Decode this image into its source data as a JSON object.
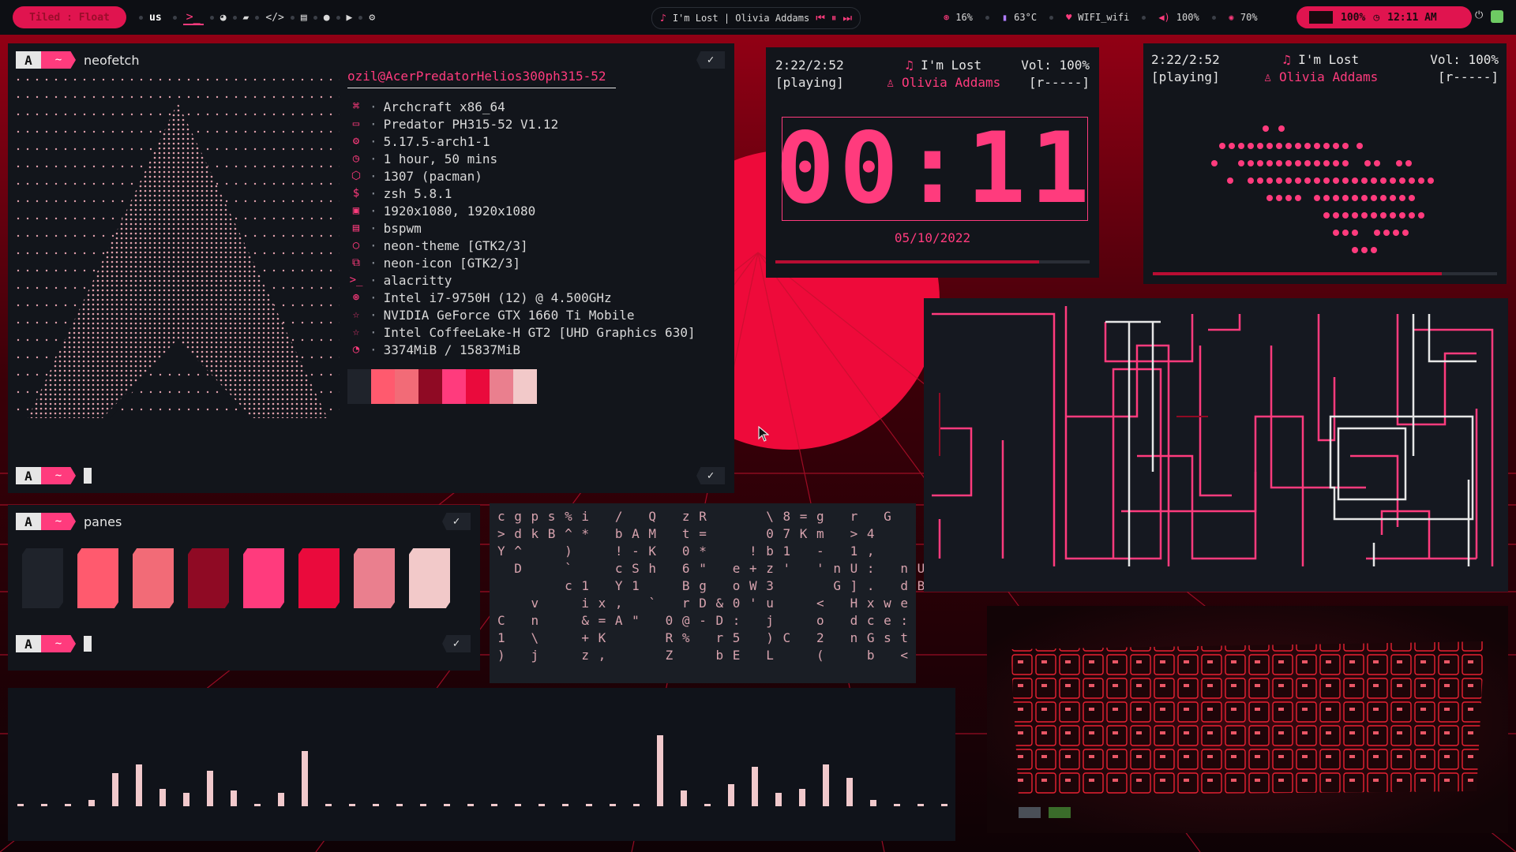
{
  "topbar": {
    "layout_label": "Tiled : Float",
    "keyboard_layout": "us",
    "workspace_icons": [
      "terminal-icon",
      "firefox-icon",
      "folder-icon",
      "code-icon",
      "notes-icon",
      "chat-icon",
      "youtube-icon",
      "settings-icon"
    ],
    "now_playing": "I'm Lost | Olivia Addams",
    "cpu": "16%",
    "temp": "63°C",
    "wifi": "WIFI_wifi",
    "volume": "100%",
    "brightness": "70%",
    "battery": "100%",
    "time": "12:11 AM",
    "accent": "#ff3b7d",
    "accent_dark": "#e0144f"
  },
  "neofetch": {
    "title": "neofetch",
    "prompt_a": "A",
    "prompt_b": "~",
    "host": "ozil@AcerPredatorHelios300ph315-52",
    "rows": [
      {
        "icon": "⌘",
        "value": "Archcraft x86_64"
      },
      {
        "icon": "▭",
        "value": "Predator PH315-52 V1.12"
      },
      {
        "icon": "⚙",
        "value": "5.17.5-arch1-1"
      },
      {
        "icon": "◷",
        "value": "1 hour, 50 mins"
      },
      {
        "icon": "⬡",
        "value": "1307 (pacman)"
      },
      {
        "icon": "$",
        "value": "zsh 5.8.1"
      },
      {
        "icon": "▣",
        "value": "1920x1080, 1920x1080"
      },
      {
        "icon": "▤",
        "value": "bspwm"
      },
      {
        "icon": "○",
        "value": "neon-theme [GTK2/3]"
      },
      {
        "icon": "⧉",
        "value": "neon-icon [GTK2/3]"
      },
      {
        "icon": ">_",
        "value": "alacritty"
      },
      {
        "icon": "⊛",
        "value": "Intel i7-9750H (12) @ 4.500GHz"
      },
      {
        "icon": "☆",
        "value": "NVIDIA GeForce GTX 1660 Ti Mobile"
      },
      {
        "icon": "☆",
        "value": "Intel CoffeeLake-H GT2 [UHD Graphics 630]"
      },
      {
        "icon": "◔",
        "value": "3374MiB / 15837MiB"
      }
    ],
    "palette": [
      "#1f232b",
      "#ff5a6e",
      "#f26b77",
      "#8f0a24",
      "#ff3b7d",
      "#ea0a3c",
      "#ea7f8e",
      "#f2c9c9"
    ]
  },
  "panes": {
    "title": "panes",
    "prompt_a": "A",
    "prompt_b": "~",
    "colors": [
      "#1f232b",
      "#ff5a6e",
      "#f26b77",
      "#8f0a24",
      "#ff3b7d",
      "#ea0a3c",
      "#ea7f8e",
      "#f2c9c9"
    ]
  },
  "matrix": {
    "lines": [
      "c g p s % i   /   Q   z R       \\ 8 = g   r   G",
      "> d k B ^ *   b A M   t =       0 7 K m   > 4",
      "Y ^     )     ! - K   0 *     ! b 1   -   1 ,",
      "  D     `     c S h   6 \"   e + z '   ' n U :   n U",
      "        c 1   Y 1     B g   o W 3       G ] .   d B",
      "    v     i x ,   `   r D & 0 ' u     <   H x w e",
      "C   n     & = A \"   0 @ - D :   j     o   d c e :",
      "1   \\     + K       R %   r 5   ) C   2   n G s t",
      ")   j     z ,       Z     b E   L     (     b   <"
    ]
  },
  "music_widget": {
    "position": "2:22/2:52",
    "state": "[playing]",
    "title": "I'm Lost",
    "artist": "Olivia Addams",
    "volume": "Vol: 100%",
    "repeat": "[r-----]",
    "clock": "00:11",
    "date": "05/10/2022",
    "progress": 0.84
  },
  "music_widget2": {
    "position": "2:22/2:52",
    "state": "[playing]",
    "title": "I'm Lost",
    "artist": "Olivia Addams",
    "volume": "Vol: 100%",
    "repeat": "[r-----]",
    "progress": 0.84
  },
  "visualizer": {
    "bars": [
      0.02,
      0.02,
      0.02,
      0.06,
      0.3,
      0.38,
      0.16,
      0.12,
      0.32,
      0.14,
      0.02,
      0.12,
      0.5,
      0.02,
      0.02,
      0.02,
      0.02,
      0.02,
      0.02,
      0.02,
      0.02,
      0.02,
      0.02,
      0.02,
      0.02,
      0.02,
      0.02,
      0.64,
      0.14,
      0.02,
      0.2,
      0.36,
      0.12,
      0.16,
      0.38,
      0.26,
      0.06,
      0.02,
      0.02,
      0.02
    ]
  }
}
